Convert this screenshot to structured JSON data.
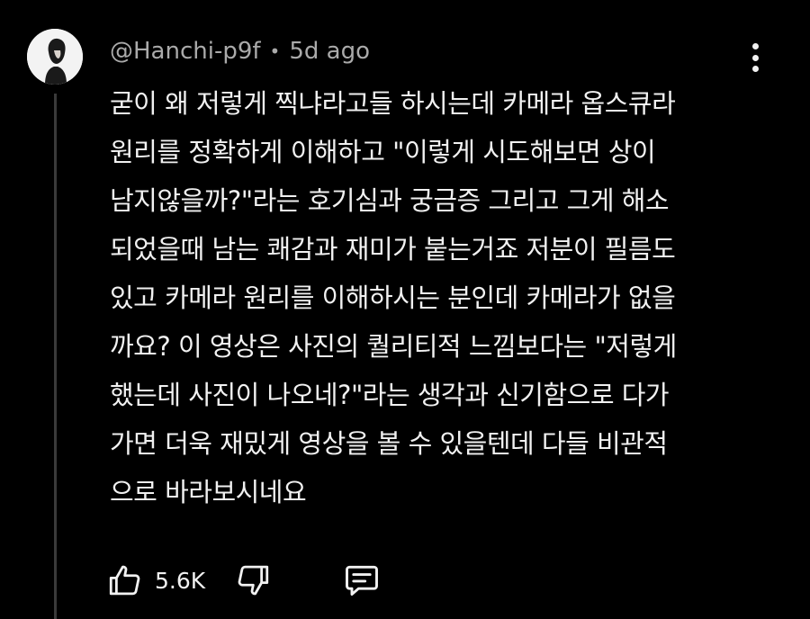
{
  "comment": {
    "author": "@Hanchi-p9f",
    "separator": "•",
    "time": "5d ago",
    "lines": [
      "굳이 왜 저렇게 찍냐라고들 하시는데 카메라 옵스큐라",
      "원리를 정확하게 이해하고 \"이렇게 시도해보면 상이",
      "남지않을까?\"라는 호기심과 궁금증 그리고 그게 해소",
      "되었을때 남는 쾌감과 재미가 붙는거죠 저분이 필름도",
      "있고 카메라 원리를 이해하시는 분인데 카메라가 없을",
      "까요? 이 영상은 사진의 퀄리티적 느낌보다는 \"저렇게",
      "했는데 사진이 나오네?\"라는 생각과 신기함으로 다가",
      "가면 더욱 재밌게 영상을 볼 수 있을텐데 다들 비관적",
      "으로 바라보시네요"
    ]
  },
  "actions": {
    "like_count": "5.6K",
    "like_icon": "thumbs-up-icon",
    "dislike_icon": "thumbs-down-icon",
    "reply_icon": "comment-reply-icon",
    "menu_icon": "more-vertical-icon"
  },
  "colors": {
    "background": "#000000",
    "text": "#f1f1f1",
    "meta": "#aaaaaa",
    "thread_line": "#3a3a3a"
  }
}
